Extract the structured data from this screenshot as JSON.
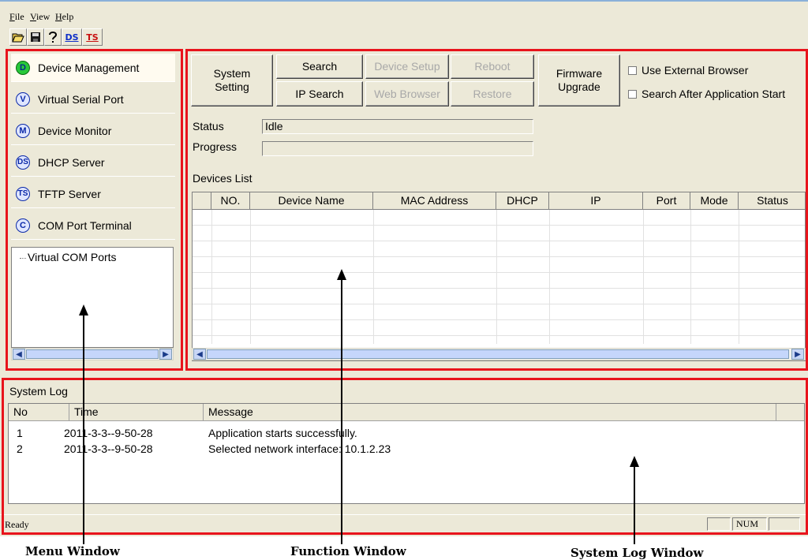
{
  "menubar": {
    "file": "File",
    "view": "View",
    "help": "Help"
  },
  "toolbar": {
    "open_icon": "folder-open-icon",
    "save_icon": "save-disk-icon",
    "help_icon": "help-question-icon",
    "ds_label": "DS",
    "ts_label": "TS"
  },
  "menu": {
    "items": [
      {
        "icon": "D",
        "label": "Device Management"
      },
      {
        "icon": "V",
        "label": "Virtual Serial Port"
      },
      {
        "icon": "M",
        "label": "Device Monitor"
      },
      {
        "icon": "DS",
        "label": "DHCP Server"
      },
      {
        "icon": "TS",
        "label": "TFTP Server"
      },
      {
        "icon": "C",
        "label": "COM Port Terminal"
      }
    ],
    "tree_root": "Virtual COM Ports"
  },
  "function": {
    "system_setting": "System Setting",
    "search": "Search",
    "ip_search": "IP Search",
    "device_setup": "Device Setup",
    "web_browser": "Web Browser",
    "reboot": "Reboot",
    "restore": "Restore",
    "firmware_upgrade": "Firmware Upgrade",
    "use_external_browser": "Use External Browser",
    "search_after_start": "Search After Application Start",
    "status_label": "Status",
    "status_value": "Idle",
    "progress_label": "Progress",
    "progress_value": "",
    "devices_list_label": "Devices List",
    "columns": [
      "NO.",
      "Device Name",
      "MAC Address",
      "DHCP",
      "IP",
      "Port",
      "Mode",
      "Status"
    ]
  },
  "log": {
    "title": "System Log",
    "columns": [
      "No",
      "Time",
      "Message"
    ],
    "rows": [
      {
        "no": "1",
        "time": "2011-3-3--9-50-28",
        "message": "Application starts successfully."
      },
      {
        "no": "2",
        "time": "2011-3-3--9-50-28",
        "message": "Selected network interface: 10.1.2.23"
      }
    ]
  },
  "status_bar": {
    "text": "Ready",
    "num": "NUM"
  },
  "annotations": {
    "menu_window": "Menu Window",
    "function_window": "Function Window",
    "system_log_window": "System Log Window"
  },
  "colors": {
    "highlight_border": "#e8141c",
    "window_bg": "#ece9d8",
    "active_icon": "#28c83a"
  }
}
